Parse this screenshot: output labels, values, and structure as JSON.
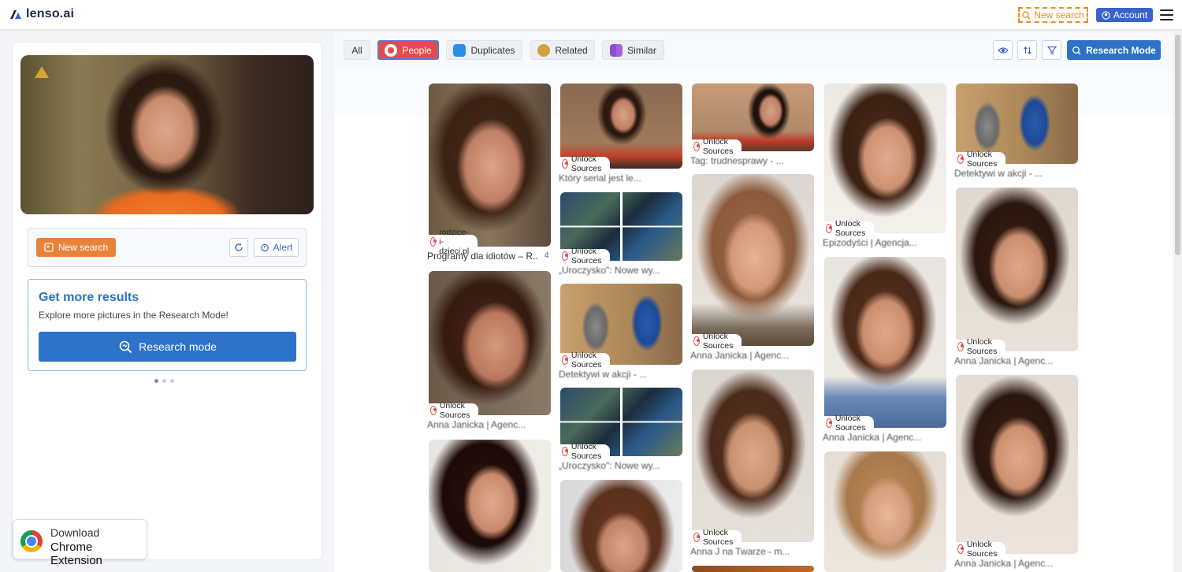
{
  "header": {
    "logo_text": "lenso.ai",
    "new_search_label": "New search",
    "account_label": "Account"
  },
  "left": {
    "new_search_label": "New search",
    "alert_label": "Alert",
    "promo_title": "Get more results",
    "promo_subtitle": "Explore more pictures in the Research Mode!",
    "research_button_label": "Research mode",
    "chrome_line1": "Download",
    "chrome_line2": "Chrome Extension"
  },
  "filters": {
    "all": "All",
    "people": "People",
    "duplicates": "Duplicates",
    "related": "Related",
    "similar": "Similar",
    "research_mode": "Research Mode"
  },
  "unlock_label": "Unlock Sources",
  "results": [
    {
      "badge": "rodzice-i-dzieci.pl",
      "caption": "Programy dla idiotów – R...",
      "count": "4"
    },
    {
      "badge": "Unlock Sources",
      "caption": "Anna Janicka | Agenc..."
    },
    {
      "badge": "",
      "caption": ""
    },
    {
      "badge": "Unlock Sources",
      "caption": "Który serial jest le..."
    },
    {
      "badge": "Unlock Sources",
      "caption": "„Uroczysko\": Nowe wy..."
    },
    {
      "badge": "Unlock Sources",
      "caption": "Detektywi w akcji - ..."
    },
    {
      "badge": "Unlock Sources",
      "caption": "„Uroczysko\": Nowe wy..."
    },
    {
      "badge": "",
      "caption": ""
    },
    {
      "badge": "Unlock Sources",
      "caption": "Tag: trudnesprawy - ..."
    },
    {
      "badge": "Unlock Sources",
      "caption": "Anna Janicka | Agenc..."
    },
    {
      "badge": "Unlock Sources",
      "caption": "Anna J na Twarze - m..."
    },
    {
      "badge": "",
      "caption": ""
    },
    {
      "badge": "Unlock Sources",
      "caption": "Epizodyści | Agencja..."
    },
    {
      "badge": "Unlock Sources",
      "caption": "Anna Janicka | Agenc..."
    },
    {
      "badge": "",
      "caption": ""
    },
    {
      "badge": "Unlock Sources",
      "caption": "Detektywi w akcji - ..."
    },
    {
      "badge": "Unlock Sources",
      "caption": "Anna Janicka | Agenc..."
    },
    {
      "badge": "Unlock Sources",
      "caption": "Anna Janicka | Agenc..."
    }
  ]
}
